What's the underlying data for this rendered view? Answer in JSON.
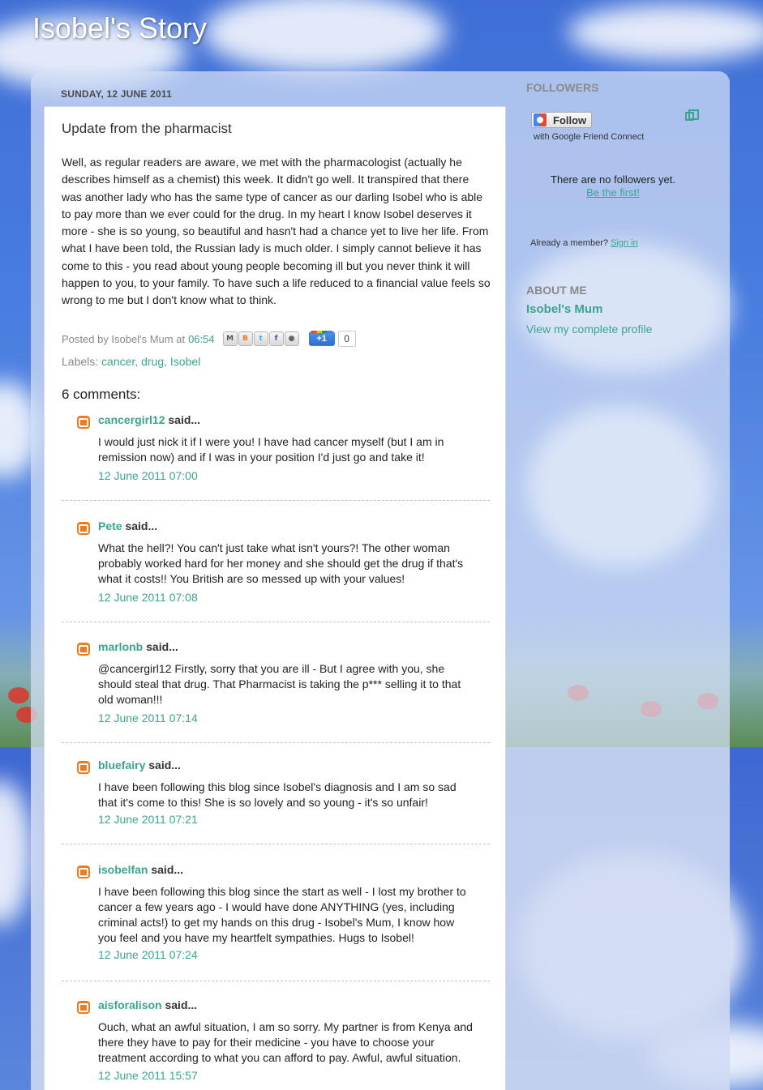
{
  "blog": {
    "title": "Isobel's Story"
  },
  "post": {
    "date": "SUNDAY, 12 JUNE 2011",
    "title": "Update from the pharmacist",
    "body": "Well, as regular readers are aware, we met with the pharmacologist (actually he describes himself as a chemist) this week.  It didn't go well.  It transpired that there was another lady who has the same type of cancer as our darling Isobel who is able to pay more than we ever could for the drug.  In my heart I know Isobel deserves it more - she is so young, so beautiful and hasn't had a chance yet to live her life.  From what I have been told, the Russian lady is much older.  I simply cannot believe it has come to this - you read about young people becoming ill but you never think it will happen to you, to your family.  To have such a life reduced to a financial value feels so wrong to me but I don't know what to think.",
    "posted_by_prefix": "Posted by Isobel's Mum at",
    "time": "06:54",
    "share_icons": [
      "email-icon",
      "blogger-icon",
      "twitter-icon",
      "facebook-icon",
      "buzz-icon"
    ],
    "plusone_label": "+1",
    "plusone_count": "0",
    "labels_prefix": "Labels:",
    "labels": [
      "cancer",
      "drug",
      "Isobel"
    ]
  },
  "comments_title": "6 comments:",
  "comments": [
    {
      "author": "cancergirl12",
      "said": " said...",
      "text": "I would just nick it if I were you!  I have had cancer myself (but I am in remission now) and if I was in your position I'd just go and take it!",
      "time": "12 June 2011 07:00"
    },
    {
      "author": "Pete",
      "said": " said...",
      "text": "What the hell?!  You can't just take what isn't yours?!  The other woman probably worked hard for her money and she should get the drug if that's what it costs!!  You British are so messed up with your values!",
      "time": "12 June 2011 07:08"
    },
    {
      "author": "marlonb",
      "said": " said...",
      "text": "@cancergirl12 Firstly, sorry that you are ill - But I agree with you, she should steal that drug.  That Pharmacist is taking the p*** selling it to that old woman!!!",
      "time": "12 June 2011 07:14"
    },
    {
      "author": "bluefairy",
      "said": " said...",
      "text": "I have been following this blog since Isobel's diagnosis and I am so sad that it's come to this!  She is so lovely and so young - it's so unfair!",
      "time": "12 June 2011 07:21"
    },
    {
      "author": "isobelfan",
      "said": " said...",
      "text": "I have been following this blog since the start as well - I lost my brother to cancer a few years ago - I would have done ANYTHING (yes, including criminal acts!) to get my hands on this drug - Isobel's Mum, I know how you feel and you have my heartfelt sympathies.  Hugs to Isobel!",
      "time": "12 June 2011 07:24"
    },
    {
      "author": "aisforalison",
      "said": " said...",
      "text": "Ouch, what an awful situation, I am so sorry. My partner is from Kenya and there they have to pay for their medicine - you have to choose your treatment according to what you can afford to pay. Awful, awful situation.",
      "time": "12 June 2011 15:57"
    }
  ],
  "sidebar": {
    "followers_heading": "FOLLOWERS",
    "follow_button": "Follow",
    "follow_sub": "with Google Friend Connect",
    "no_followers": "There are no followers yet.",
    "be_first": "Be the first!",
    "already_member": "Already a member?",
    "sign_in": "Sign in",
    "about_heading": "ABOUT ME",
    "author_name": "Isobel's Mum",
    "view_profile": "View my complete profile"
  },
  "colors": {
    "link": "#3aa58e",
    "sky": "#4a7ee0",
    "blogger_orange": "#f07b1b"
  }
}
